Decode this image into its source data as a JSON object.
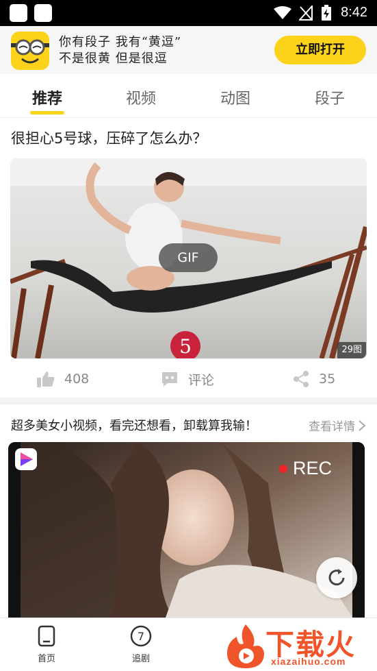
{
  "status_bar": {
    "time": "8:42"
  },
  "banner": {
    "slogan_line1_a": "你有段子 我有",
    "slogan_line1_b": "“黄逗”",
    "slogan_line2": "不是很黄 但是很逗",
    "open_button": "立即打开"
  },
  "tabs": [
    {
      "label": "推荐",
      "active": true
    },
    {
      "label": "视频",
      "active": false
    },
    {
      "label": "动图",
      "active": false
    },
    {
      "label": "段子",
      "active": false
    }
  ],
  "post1": {
    "title": "很担心5号球，压碎了怎么办？",
    "media_badge": "GIF",
    "image_count": "29图",
    "likes": "408",
    "comment_label": "评论",
    "shares": "35"
  },
  "post2": {
    "title": "超多美女小视频，看完还想看，卸载算我输！",
    "detail_link": "查看详情",
    "rec_label": "REC"
  },
  "bottom_nav": [
    {
      "label": "首页"
    },
    {
      "label": "追剧"
    }
  ],
  "watermark": {
    "brand": "下载火",
    "url": "xiazaihuo.com"
  },
  "colors": {
    "accent": "#fcd21a",
    "rec": "#f2222b",
    "watermark": "#f0542a"
  }
}
